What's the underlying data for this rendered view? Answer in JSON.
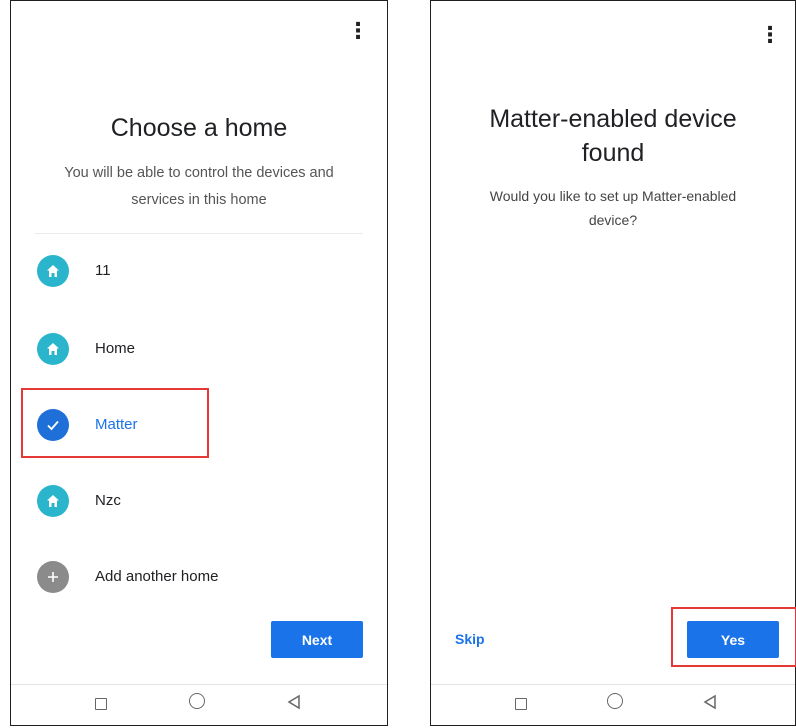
{
  "left_screen": {
    "title": "Choose a home",
    "subtitle_line1": "You will be able to control the devices and",
    "subtitle_line2": "services in this home",
    "homes": [
      {
        "label": "11",
        "icon": "home-icon",
        "selected": false
      },
      {
        "label": "Home",
        "icon": "home-icon",
        "selected": false
      },
      {
        "label": "Matter",
        "icon": "check-icon",
        "selected": true
      },
      {
        "label": "Nzc",
        "icon": "home-icon",
        "selected": false
      }
    ],
    "add_home_label": "Add another home",
    "next_label": "Next"
  },
  "right_screen": {
    "title_line1": "Matter-enabled device",
    "title_line2": "found",
    "subtitle_line1": "Would you like to set up Matter-enabled",
    "subtitle_line2": "device?",
    "skip_label": "Skip",
    "yes_label": "Yes"
  },
  "colors": {
    "accent": "#1a73e8",
    "home_icon_bg": "#2bb5cc",
    "selected_icon_bg": "#1f6fd9",
    "add_icon_bg": "#8b8b8b",
    "highlight": "#e53935"
  }
}
